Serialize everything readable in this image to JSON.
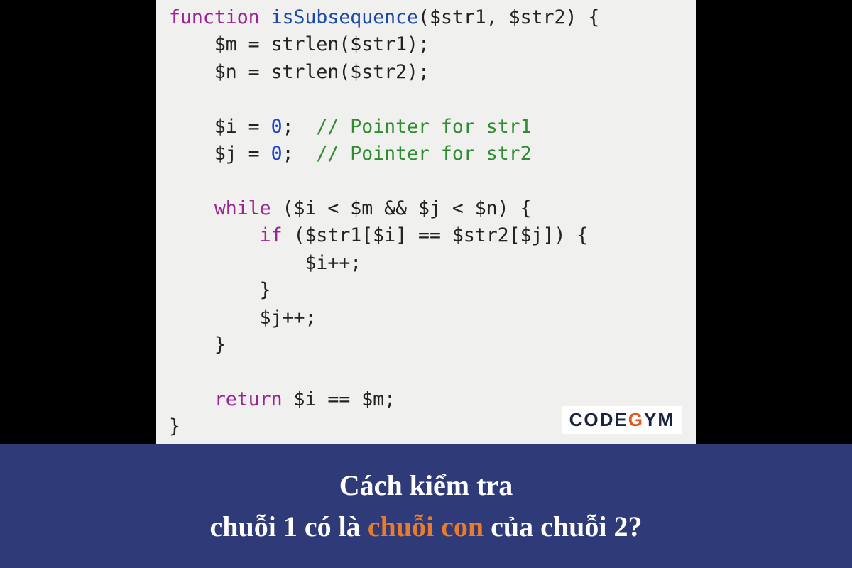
{
  "code": {
    "l1": {
      "kw": "function",
      "fn": "isSubsequence",
      "args": "($str1, $str2) {"
    },
    "l2": "    $m = strlen($str1);",
    "l3": "    $n = strlen($str2);",
    "l4": "",
    "l5a": "    $i = ",
    "l5n": "0",
    "l5b": ";  ",
    "l5c": "// Pointer for str1",
    "l6a": "    $j = ",
    "l6n": "0",
    "l6b": ";  ",
    "l6c": "// Pointer for str2",
    "l7": "",
    "l8kw": "    while",
    "l8r": " ($i < $m && $j < $n) {",
    "l9kw": "        if",
    "l9r": " ($str1[$i] == $str2[$j]) {",
    "l10": "            $i++;",
    "l11": "        }",
    "l12": "        $j++;",
    "l13": "    }",
    "l14": "",
    "l15kw": "    return",
    "l15r": " $i == $m;",
    "l16": "}"
  },
  "logo": {
    "pre": "CODE",
    "post": "YM"
  },
  "caption": {
    "line1": "Cách kiểm tra",
    "line2a": "chuỗi 1 có là ",
    "line2hl": "chuỗi con",
    "line2b": " của chuỗi 2?"
  }
}
